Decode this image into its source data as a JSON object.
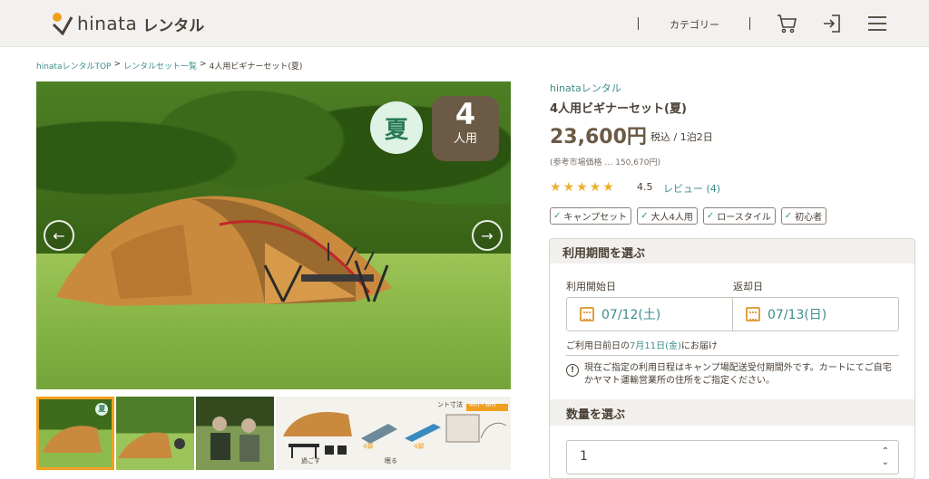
{
  "header": {
    "logo_text": "hinata",
    "logo_sub": "レンタル",
    "category_label": "カテゴリー",
    "icons": [
      "cart-icon",
      "login-icon",
      "menu-icon"
    ]
  },
  "breadcrumb": {
    "items": [
      "hinataレンタルTOP",
      "レンタルセット一覧",
      "4人用ビギナーセット(夏)"
    ],
    "separator": ">"
  },
  "gallery": {
    "season_badge": "夏",
    "people_number": "4",
    "people_unit": "人用",
    "prev_arrow": "←",
    "next_arrow": "→",
    "thumb_badge": "夏",
    "thumb4_labels": [
      "ント寸法",
      "4m - 6m",
      "過ごす",
      "眠る",
      "4脚",
      "4脚"
    ]
  },
  "product": {
    "shop": "hinataレンタル",
    "title": "4人用ビギナーセット(夏)",
    "price": "23,600円",
    "price_note": "税込 / 1泊2日",
    "ref_price": "(参考市場価格 … 150,670円)",
    "rating_value": "4.5",
    "stars": 4.5,
    "review_link": "レビュー (4)",
    "tags": [
      "キャンプセット",
      "大人4人用",
      "ロースタイル",
      "初心者"
    ]
  },
  "booking": {
    "section_title": "利用期間を選ぶ",
    "start_label": "利用開始日",
    "end_label": "返却日",
    "start_date": "07/12(土)",
    "end_date": "07/13(日)",
    "delivery_prefix": "ご利用日前日の",
    "delivery_date": "7月11日(金)",
    "delivery_suffix": "にお届け",
    "warning": "現在ご指定の利用日程はキャンプ場配送受付期間外です。カートにてご自宅かヤマト運輸営業所の住所をご指定ください。",
    "qty_title": "数量を選ぶ",
    "qty_value": "1"
  },
  "colors": {
    "accent_teal": "#3b8e8a",
    "brown": "#6b5a45",
    "star": "#f0b030",
    "highlight_border": "#f0a020"
  }
}
